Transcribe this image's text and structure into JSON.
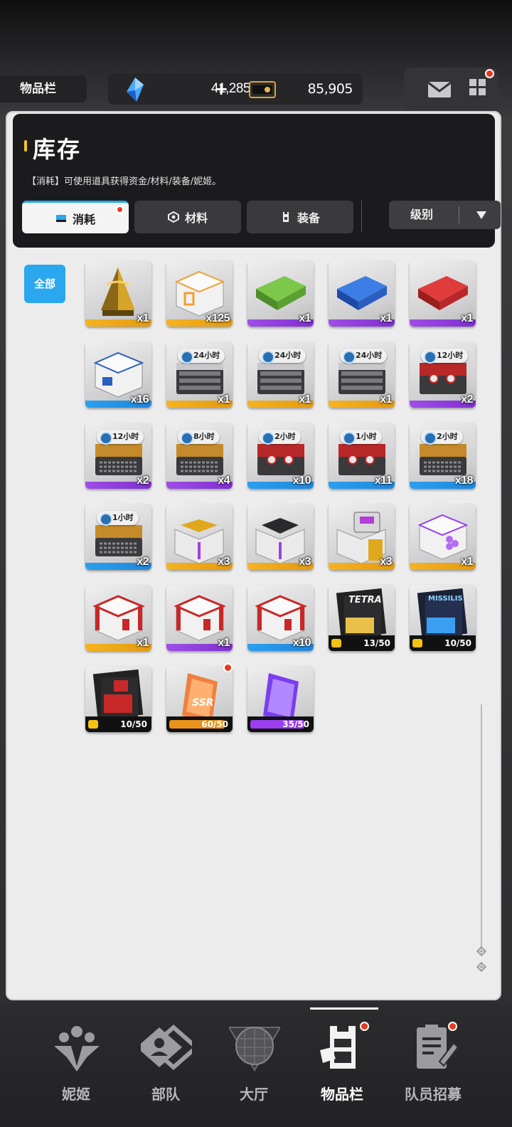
{
  "header": {
    "screen_title": "物品栏",
    "gems": "41,285",
    "gems_plus": "+",
    "tickets": "85,905"
  },
  "panel": {
    "title": "库存",
    "description": "【消耗】可使用道具获得资金/材料/装备/妮姬。",
    "tabs": [
      {
        "label": "消耗",
        "active": true
      },
      {
        "label": "材料",
        "active": false
      },
      {
        "label": "装备",
        "active": false
      }
    ],
    "sort_label": "级别",
    "filter_all": "全部"
  },
  "items": [
    {
      "qty": "x1",
      "rarity": "gold",
      "kind": "gold-pyramid"
    },
    {
      "qty": "x125",
      "rarity": "gold",
      "kind": "white-box-orange"
    },
    {
      "qty": "x1",
      "rarity": "purple",
      "kind": "green-case"
    },
    {
      "qty": "x1",
      "rarity": "purple",
      "kind": "blue-case"
    },
    {
      "qty": "x1",
      "rarity": "purple",
      "kind": "red-case"
    },
    {
      "qty": "x16",
      "rarity": "blue",
      "kind": "white-box-blue"
    },
    {
      "qty": "x1",
      "rarity": "gold",
      "kind": "rack-case",
      "timer": "24小时"
    },
    {
      "qty": "x1",
      "rarity": "gold",
      "kind": "rack-case",
      "timer": "24小时"
    },
    {
      "qty": "x1",
      "rarity": "gold",
      "kind": "rack-case",
      "timer": "24小时"
    },
    {
      "qty": "x2",
      "rarity": "purple",
      "kind": "orb-case",
      "timer": "12小时"
    },
    {
      "qty": "x2",
      "rarity": "purple",
      "kind": "credit-case",
      "timer": "12小时"
    },
    {
      "qty": "x4",
      "rarity": "purple",
      "kind": "credit-case",
      "timer": "8小时"
    },
    {
      "qty": "x10",
      "rarity": "blue",
      "kind": "orb-case",
      "timer": "2小时"
    },
    {
      "qty": "x11",
      "rarity": "blue",
      "kind": "orb-case",
      "timer": "1小时"
    },
    {
      "qty": "x18",
      "rarity": "blue",
      "kind": "credit-case",
      "timer": "2小时"
    },
    {
      "qty": "x2",
      "rarity": "blue",
      "kind": "credit-case",
      "timer": "1小时"
    },
    {
      "qty": "x3",
      "rarity": "gold",
      "kind": "open-crate-gold"
    },
    {
      "qty": "x3",
      "rarity": "gold",
      "kind": "open-crate-black"
    },
    {
      "qty": "x3",
      "rarity": "gold",
      "kind": "open-crate-tech"
    },
    {
      "qty": "x1",
      "rarity": "gold",
      "kind": "white-box-purple"
    },
    {
      "qty": "x1",
      "rarity": "gold",
      "kind": "red-box"
    },
    {
      "qty": "x1",
      "rarity": "purple",
      "kind": "red-box"
    },
    {
      "qty": "x10",
      "rarity": "blue",
      "kind": "red-box"
    },
    {
      "kind": "manual-tetra",
      "frag": "13/50",
      "label": "TETRA"
    },
    {
      "kind": "manual-missilis",
      "frag": "10/50",
      "label": "MISSILIS"
    },
    {
      "kind": "manual-red",
      "frag": "10/50"
    },
    {
      "kind": "ssr-shard",
      "frag": "60/50",
      "fill": "orange",
      "label": "SSR",
      "dot": true
    },
    {
      "kind": "purple-shard",
      "frag": "35/50",
      "fill": "purple"
    }
  ],
  "nav": [
    {
      "label": "妮姬",
      "icon": "nikke-icon"
    },
    {
      "label": "部队",
      "icon": "squad-icon"
    },
    {
      "label": "大厅",
      "icon": "lobby-icon"
    },
    {
      "label": "物品栏",
      "icon": "inventory-icon",
      "active": true,
      "dot": true
    },
    {
      "label": "队员招募",
      "icon": "recruit-icon",
      "dot": true
    }
  ]
}
